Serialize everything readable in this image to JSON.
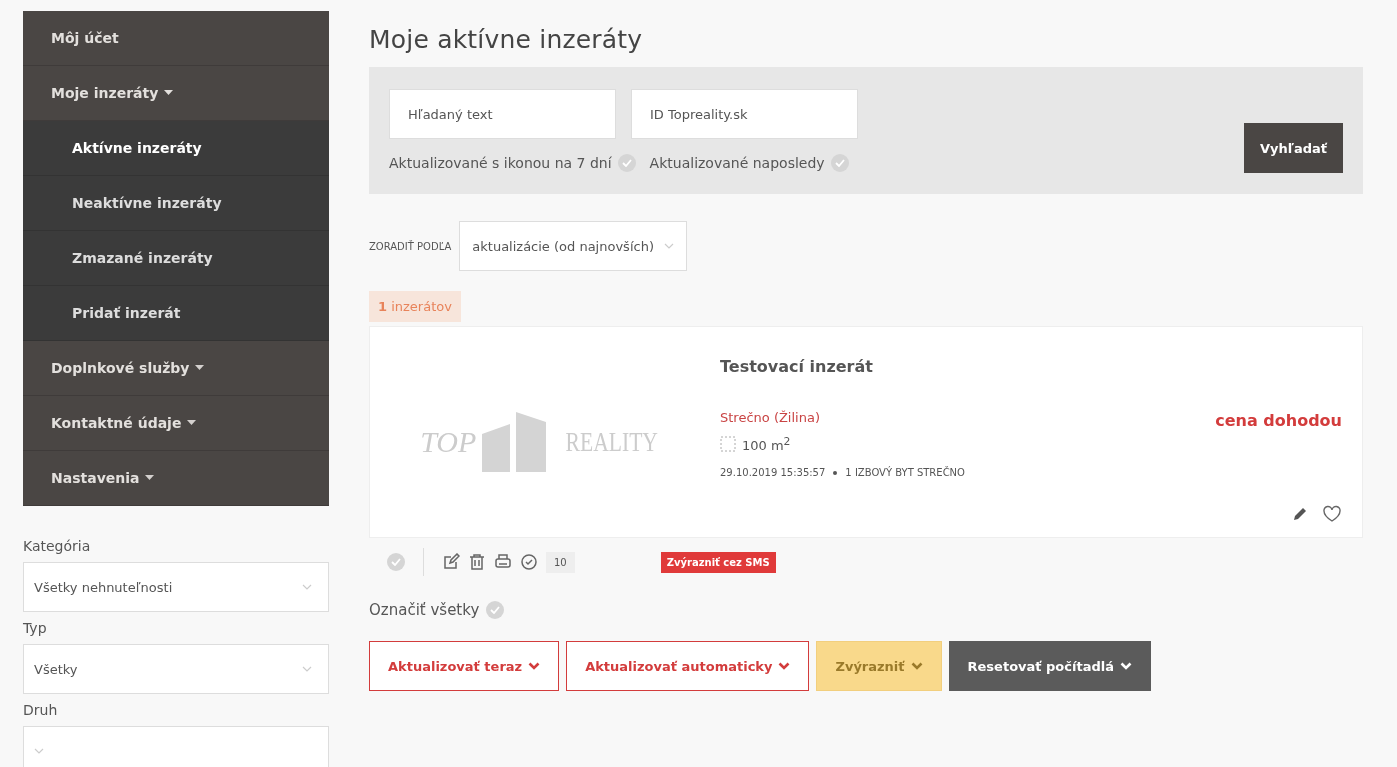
{
  "sidebar": {
    "menu": [
      {
        "label": "Môj účet",
        "kind": "link",
        "selected": false
      },
      {
        "label": "Moje inzeráty",
        "kind": "dropdown",
        "selected": false,
        "expanded": true,
        "children": [
          {
            "label": "Aktívne inzeráty",
            "selected": true
          },
          {
            "label": "Neaktívne inzeráty",
            "selected": false
          },
          {
            "label": "Zmazané inzeráty",
            "selected": false
          },
          {
            "label": "Pridať inzerát",
            "selected": false
          }
        ]
      },
      {
        "label": "Doplnkové služby",
        "kind": "dropdown",
        "selected": false,
        "expanded": false
      },
      {
        "label": "Kontaktné údaje",
        "kind": "dropdown",
        "selected": false,
        "expanded": false
      },
      {
        "label": "Nastavenia",
        "kind": "dropdown",
        "selected": false,
        "expanded": false
      }
    ],
    "filters": [
      {
        "label": "Kategória",
        "value": "Všetky nehnuteľnosti"
      },
      {
        "label": "Typ",
        "value": "Všetky"
      },
      {
        "label": "Druh"
      }
    ]
  },
  "main": {
    "title": "Moje aktívne inzeráty",
    "search": {
      "text_placeholder": "Hľadaný text",
      "id_placeholder": "ID Topreality.sk",
      "checks": [
        {
          "label": "Aktualizované s ikonou na 7 dní",
          "checked": false
        },
        {
          "label": "Aktualizované naposledy",
          "checked": false
        }
      ],
      "button": "Vyhľadať"
    },
    "sort": {
      "label": "ZORADIŤ PODĽA",
      "value": "aktualizácie (od najnovších)"
    },
    "count": {
      "number": "1",
      "label": "inzerátov"
    },
    "listing": {
      "image_logo": [
        "TOP",
        "REALITY"
      ],
      "title": "Testovací inzerát",
      "location": "Strečno (Žilina)",
      "area": "100 m$^{2}$",
      "date": "29.10.2019 15:35:57",
      "category": "1 IZBOVÝ BYT STREČNO",
      "price": "cena dohodou",
      "favorite": false,
      "selected": false,
      "views": "10",
      "sms_button": "Zvýrazniť cez SMS"
    },
    "select_all": {
      "label": "Označiť všetky",
      "checked": false
    },
    "actions": [
      {
        "label": "Aktualizovať teraz",
        "kind": "outline"
      },
      {
        "label": "Aktualizovať automaticky",
        "kind": "outline"
      },
      {
        "label": "Zvýrazniť",
        "kind": "highlight"
      },
      {
        "label": "Resetovať počítadlá",
        "kind": "dark"
      }
    ]
  }
}
